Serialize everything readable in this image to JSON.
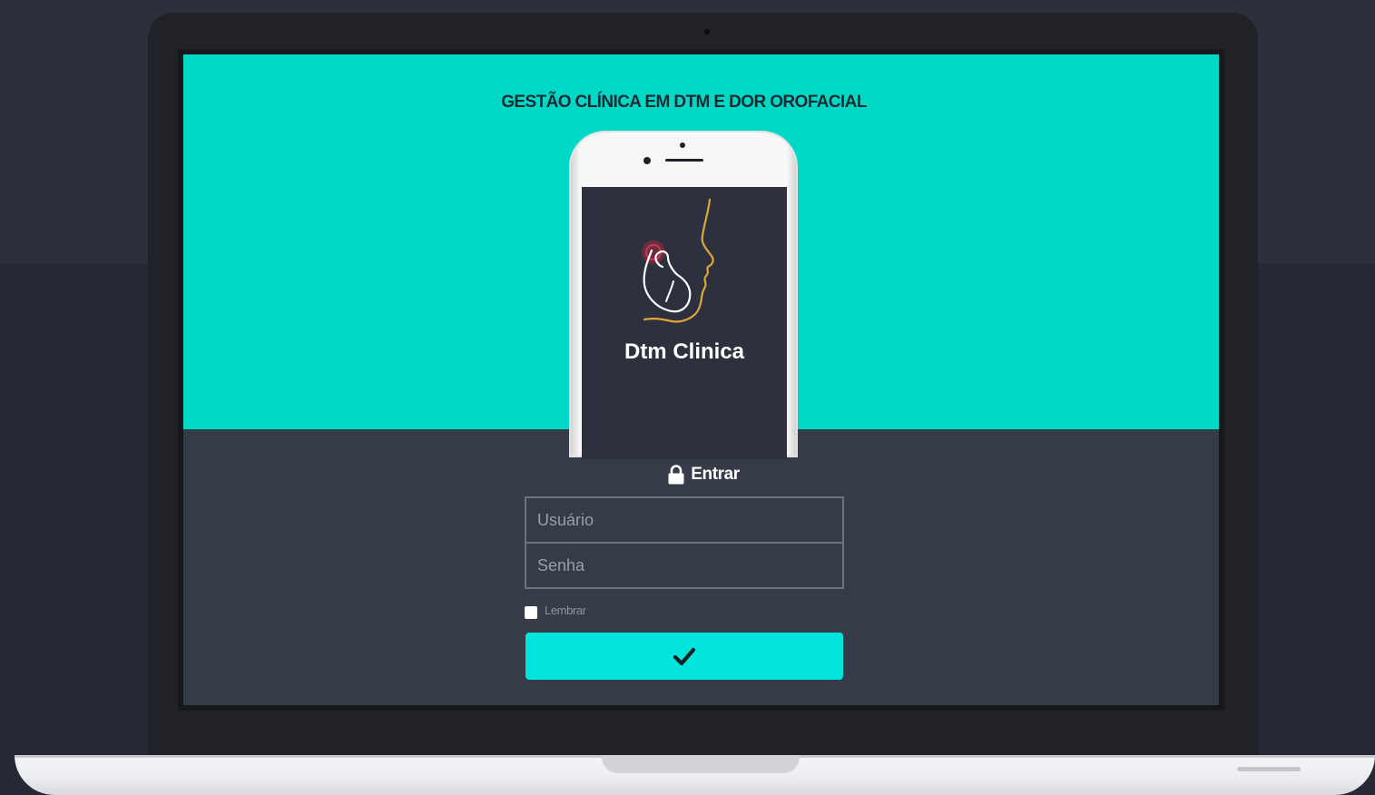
{
  "hero": {
    "tagline": "GESTÃO CLÍNICA EM DTM E DOR OROFACIAL",
    "app_name": "Dtm Clinica",
    "background_color": "#00d8c8"
  },
  "login": {
    "title": "Entrar",
    "title_icon": "lock-icon",
    "username_placeholder": "Usuário",
    "password_placeholder": "Senha",
    "remember_label": "Lembrar",
    "remember_checked": false,
    "submit_icon": "check-icon",
    "submit_color": "#00e4dc",
    "panel_color": "#353b47"
  }
}
